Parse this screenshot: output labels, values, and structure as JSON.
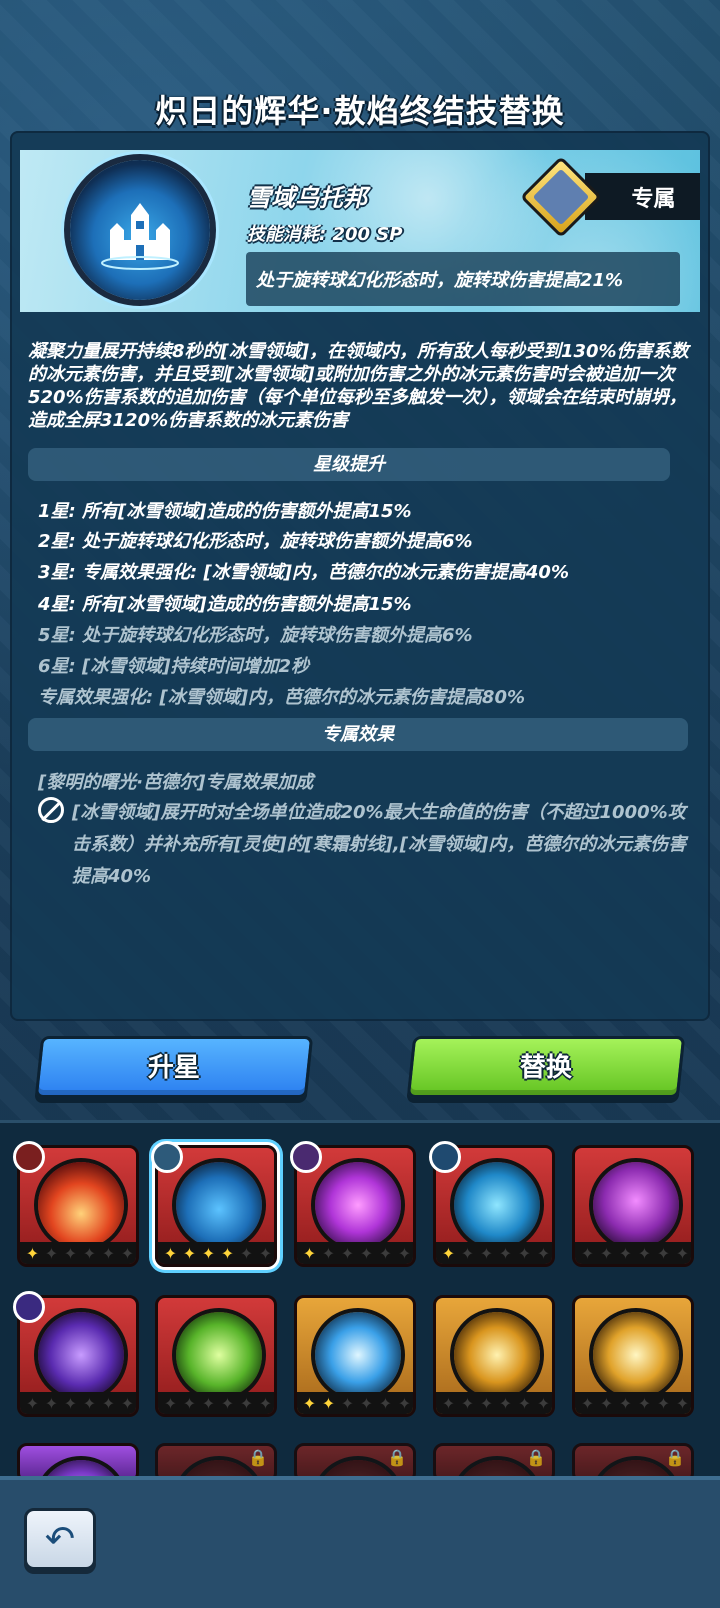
{
  "title": "炽日的辉华·敖焰终结技替换",
  "skill": {
    "name": "雪域乌托邦",
    "cost": "技能消耗: 200 SP",
    "exclusive_label": "专属",
    "passive": "处于旋转球幻化形态时，旋转球伤害提高21%"
  },
  "description": "凝聚力量展开持续8秒的[冰雪领域]，在领域内，所有敌人每秒受到130%伤害系数的冰元素伤害，并且受到[冰雪领域]或附加伤害之外的冰元素伤害时会被追加一次520%伤害系数的追加伤害（每个单位每秒至多触发一次），领域会在结束时崩坍，造成全屏3120%伤害系数的冰元素伤害",
  "star_section_title": "星级提升",
  "star_upgrades": [
    {
      "text": "1星: 所有[冰雪领域]造成的伤害额外提高15%",
      "active": true
    },
    {
      "text": "2星: 处于旋转球幻化形态时，旋转球伤害额外提高6%",
      "active": true
    },
    {
      "text": "3星: 专属效果强化: [冰雪领域]内，芭德尔的冰元素伤害提高40%",
      "active": true
    },
    {
      "text": "4星: 所有[冰雪领域]造成的伤害额外提高15%",
      "active": true
    },
    {
      "text": "5星: 处于旋转球幻化形态时，旋转球伤害额外提高6%",
      "active": false
    },
    {
      "text": "6星: [冰雪领域]持续时间增加2秒",
      "active": false
    },
    {
      "text": "专属效果强化: [冰雪领域]内，芭德尔的冰元素伤害提高80%",
      "active": false
    }
  ],
  "exclusive_section_title": "专属效果",
  "exclusive": {
    "title": "[黎明的曙光·芭德尔]专属效果加成",
    "text": "[冰雪领域]展开时对全场单位造成20%最大生命值的伤害（不超过1000%攻击系数）并补充所有[灵使]的[寒霜射线],[冰雪领域]内，芭德尔的冰元素伤害提高40%"
  },
  "buttons": {
    "star_up": "升星",
    "replace": "替换"
  },
  "colors": {
    "accent_blue": "#2b7ff0",
    "accent_green": "#63c322",
    "star_gold": "#ffd43a"
  },
  "skills_grid": [
    {
      "icon": "fire-burst-icon",
      "frame": "red",
      "stars": 1,
      "emblem": true,
      "selected": false,
      "locked": false
    },
    {
      "icon": "ice-castle-icon",
      "frame": "red",
      "stars": 4,
      "emblem": true,
      "selected": true,
      "locked": false
    },
    {
      "icon": "void-orb-icon",
      "frame": "red",
      "stars": 1,
      "emblem": true,
      "selected": false,
      "locked": false
    },
    {
      "icon": "yin-yang-icon",
      "frame": "red",
      "stars": 1,
      "emblem": true,
      "selected": false,
      "locked": false
    },
    {
      "icon": "cauldron-icon",
      "frame": "red",
      "stars": 0,
      "emblem": false,
      "selected": false,
      "locked": false
    },
    {
      "icon": "shadow-claw-icon",
      "frame": "red",
      "stars": 0,
      "emblem": true,
      "selected": false,
      "locked": false
    },
    {
      "icon": "wind-swirl-icon",
      "frame": "red",
      "stars": 0,
      "emblem": false,
      "selected": false,
      "locked": false
    },
    {
      "icon": "ice-shard-icon",
      "frame": "gold",
      "stars": 2,
      "emblem": false,
      "selected": false,
      "locked": false
    },
    {
      "icon": "lightning-strike-icon",
      "frame": "gold",
      "stars": 0,
      "emblem": false,
      "selected": false,
      "locked": false
    },
    {
      "icon": "thunder-bolt-icon",
      "frame": "gold",
      "stars": 0,
      "emblem": false,
      "selected": false,
      "locked": false
    },
    {
      "icon": "arcane-icon",
      "frame": "purple",
      "stars": 0,
      "emblem": false,
      "selected": false,
      "locked": false
    },
    {
      "icon": "locked-skill-icon",
      "frame": "locked",
      "stars": 0,
      "emblem": false,
      "selected": false,
      "locked": true
    },
    {
      "icon": "locked-skill-icon",
      "frame": "locked",
      "stars": 0,
      "emblem": false,
      "selected": false,
      "locked": true
    },
    {
      "icon": "locked-skill-icon",
      "frame": "locked",
      "stars": 0,
      "emblem": false,
      "selected": false,
      "locked": true
    },
    {
      "icon": "locked-skill-icon",
      "frame": "locked",
      "stars": 0,
      "emblem": false,
      "selected": false,
      "locked": true
    }
  ],
  "back_icon": "back-arrow-icon"
}
